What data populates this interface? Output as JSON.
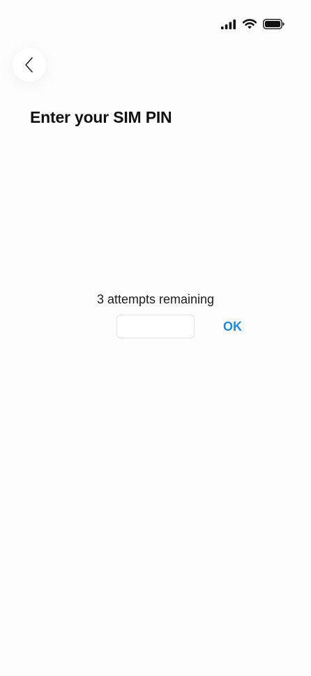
{
  "status_bar": {
    "icons": [
      "cellular-signal-icon",
      "wifi-icon",
      "battery-icon"
    ]
  },
  "header": {
    "back_icon": "chevron-left-icon",
    "title": "Enter your SIM PIN"
  },
  "pin_entry": {
    "attempts_text": "3 attempts remaining",
    "input_value": "",
    "input_placeholder": "",
    "ok_label": "OK"
  },
  "colors": {
    "accent": "#1f8ad6",
    "background": "#fdfdfd",
    "text": "#111111"
  }
}
